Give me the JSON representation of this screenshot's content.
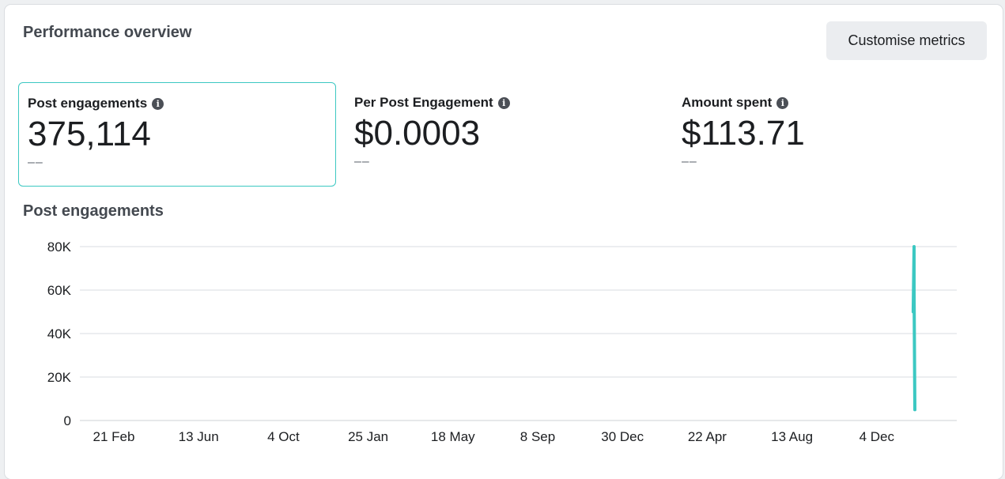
{
  "header": {
    "title": "Performance overview",
    "customise_label": "Customise metrics"
  },
  "metrics": [
    {
      "label": "Post engagements",
      "value": "375,114",
      "delta": "––",
      "selected": true
    },
    {
      "label": "Per Post Engagement",
      "value": "$0.0003",
      "delta": "––",
      "selected": false
    },
    {
      "label": "Amount spent",
      "value": "$113.71",
      "delta": "––",
      "selected": false
    }
  ],
  "info_icon": "info-icon",
  "chart_data": {
    "type": "line",
    "title": "Post engagements",
    "xlabel": "",
    "ylabel": "",
    "ylim": [
      0,
      80000
    ],
    "y_ticks": [
      0,
      20000,
      40000,
      60000,
      80000
    ],
    "y_tick_labels": [
      "0",
      "20K",
      "40K",
      "60K",
      "80K"
    ],
    "x_tick_labels": [
      "21 Feb",
      "13 Jun",
      "4 Oct",
      "25 Jan",
      "18 May",
      "8 Sep",
      "30 Dec",
      "22 Apr",
      "13 Aug",
      "4 Dec"
    ],
    "x_tick_index": [
      0,
      1,
      2,
      3,
      4,
      5,
      6,
      7,
      8,
      9
    ],
    "series": [
      {
        "color": "#3cc8c2",
        "x": [
          9.43,
          9.44,
          9.44,
          9.45
        ],
        "y": [
          50000,
          80000,
          60000,
          5000
        ]
      }
    ],
    "grid": true
  }
}
